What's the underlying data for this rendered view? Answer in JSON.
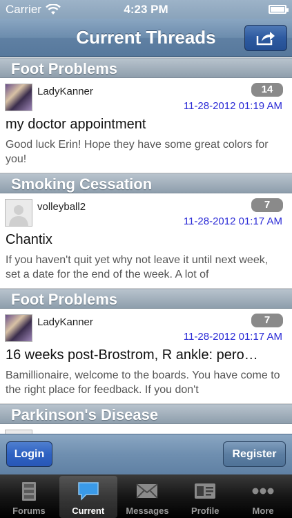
{
  "status_bar": {
    "carrier": "Carrier",
    "time": "4:23 PM"
  },
  "nav": {
    "title": "Current Threads",
    "action_icon": "share-icon"
  },
  "threads": [
    {
      "forum": "Foot Problems",
      "user": "LadyKanner",
      "avatar": "avatar-photo",
      "count": "14",
      "date": "11-28-2012 01:19 AM",
      "subject": "my doctor appointment",
      "preview": "Good luck Erin!  Hope they have some great colors for you!"
    },
    {
      "forum": "Smoking Cessation",
      "user": "volleyball2",
      "avatar": "avatar-default",
      "count": "7",
      "date": "11-28-2012 01:17 AM",
      "subject": "Chantix",
      "preview": "If you haven't quit yet why not leave it until next week, set a date for the end of the week.  A lot of"
    },
    {
      "forum": "Foot Problems",
      "user": "LadyKanner",
      "avatar": "avatar-photo",
      "count": "7",
      "date": "11-28-2012 01:17 AM",
      "subject": "16 weeks post-Brostrom, R ankle: pero…",
      "preview": "Bamillionaire, welcome to the boards.  You have come to the right place for feedback.  If you don't"
    },
    {
      "forum": "Parkinson's Disease"
    }
  ],
  "auth": {
    "login_label": "Login",
    "register_label": "Register"
  },
  "tabs": [
    {
      "label": "Forums",
      "icon": "cabinet-icon",
      "active": false
    },
    {
      "label": "Current",
      "icon": "chat-bubble-icon",
      "active": true
    },
    {
      "label": "Messages",
      "icon": "envelope-icon",
      "active": false
    },
    {
      "label": "Profile",
      "icon": "id-card-icon",
      "active": false
    },
    {
      "label": "More",
      "icon": "ellipsis-icon",
      "active": false
    }
  ],
  "colors": {
    "timestamp": "#2a2ad6",
    "badge": "#8a8a8a",
    "nav_blue": "#5f80a3",
    "login_blue": "#2f62c2"
  }
}
